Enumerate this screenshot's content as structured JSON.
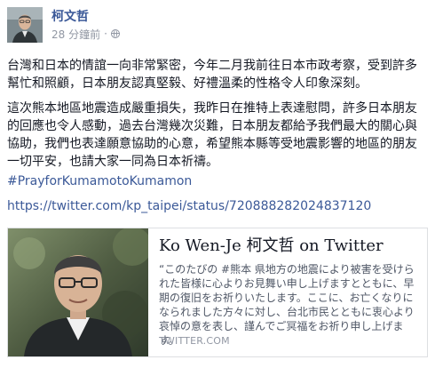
{
  "post": {
    "author": "柯文哲",
    "timestamp": "28 分鐘前",
    "separator": "·",
    "audience_icon": "globe-icon",
    "paragraph_1": "台灣和日本的情誼一向非常緊密，今年二月我前往日本市政考察，受到許多幫忙和照顧，日本朋友認真堅毅、好禮溫柔的性格令人印象深刻。",
    "paragraph_2": "這次熊本地區地震造成嚴重損失，我昨日在推特上表達慰問，許多日本朋友的回應也令人感動，過去台灣幾次災難，日本朋友都給予我們最大的關心與協助，我們也表達願意協助的心意，希望熊本縣等受地震影響的地區的朋友一切平安，也請大家一同為日本祈禱。",
    "hashtag": "#PrayforKumamotoKumamon",
    "link": "https://twitter.com/kp_taipei/status/720888282024837120"
  },
  "share_card": {
    "title": "Ko Wen-Je 柯文哲 on Twitter",
    "description": "“このたびの #熊本 県地方の地震により被害を受けられた皆様に心よりお見舞い申し上げますとともに、早期の復旧をお祈りいたします。ここに、お亡くなりになられました方々に対し、台北市民とともに衷心より哀悼の意を表し、謹んでご冥福をお祈り申し上げます。",
    "domain": "TWITTER.COM"
  },
  "colors": {
    "link": "#3b5998",
    "text": "#141823",
    "meta": "#9197a3",
    "border": "#dddfe2"
  }
}
